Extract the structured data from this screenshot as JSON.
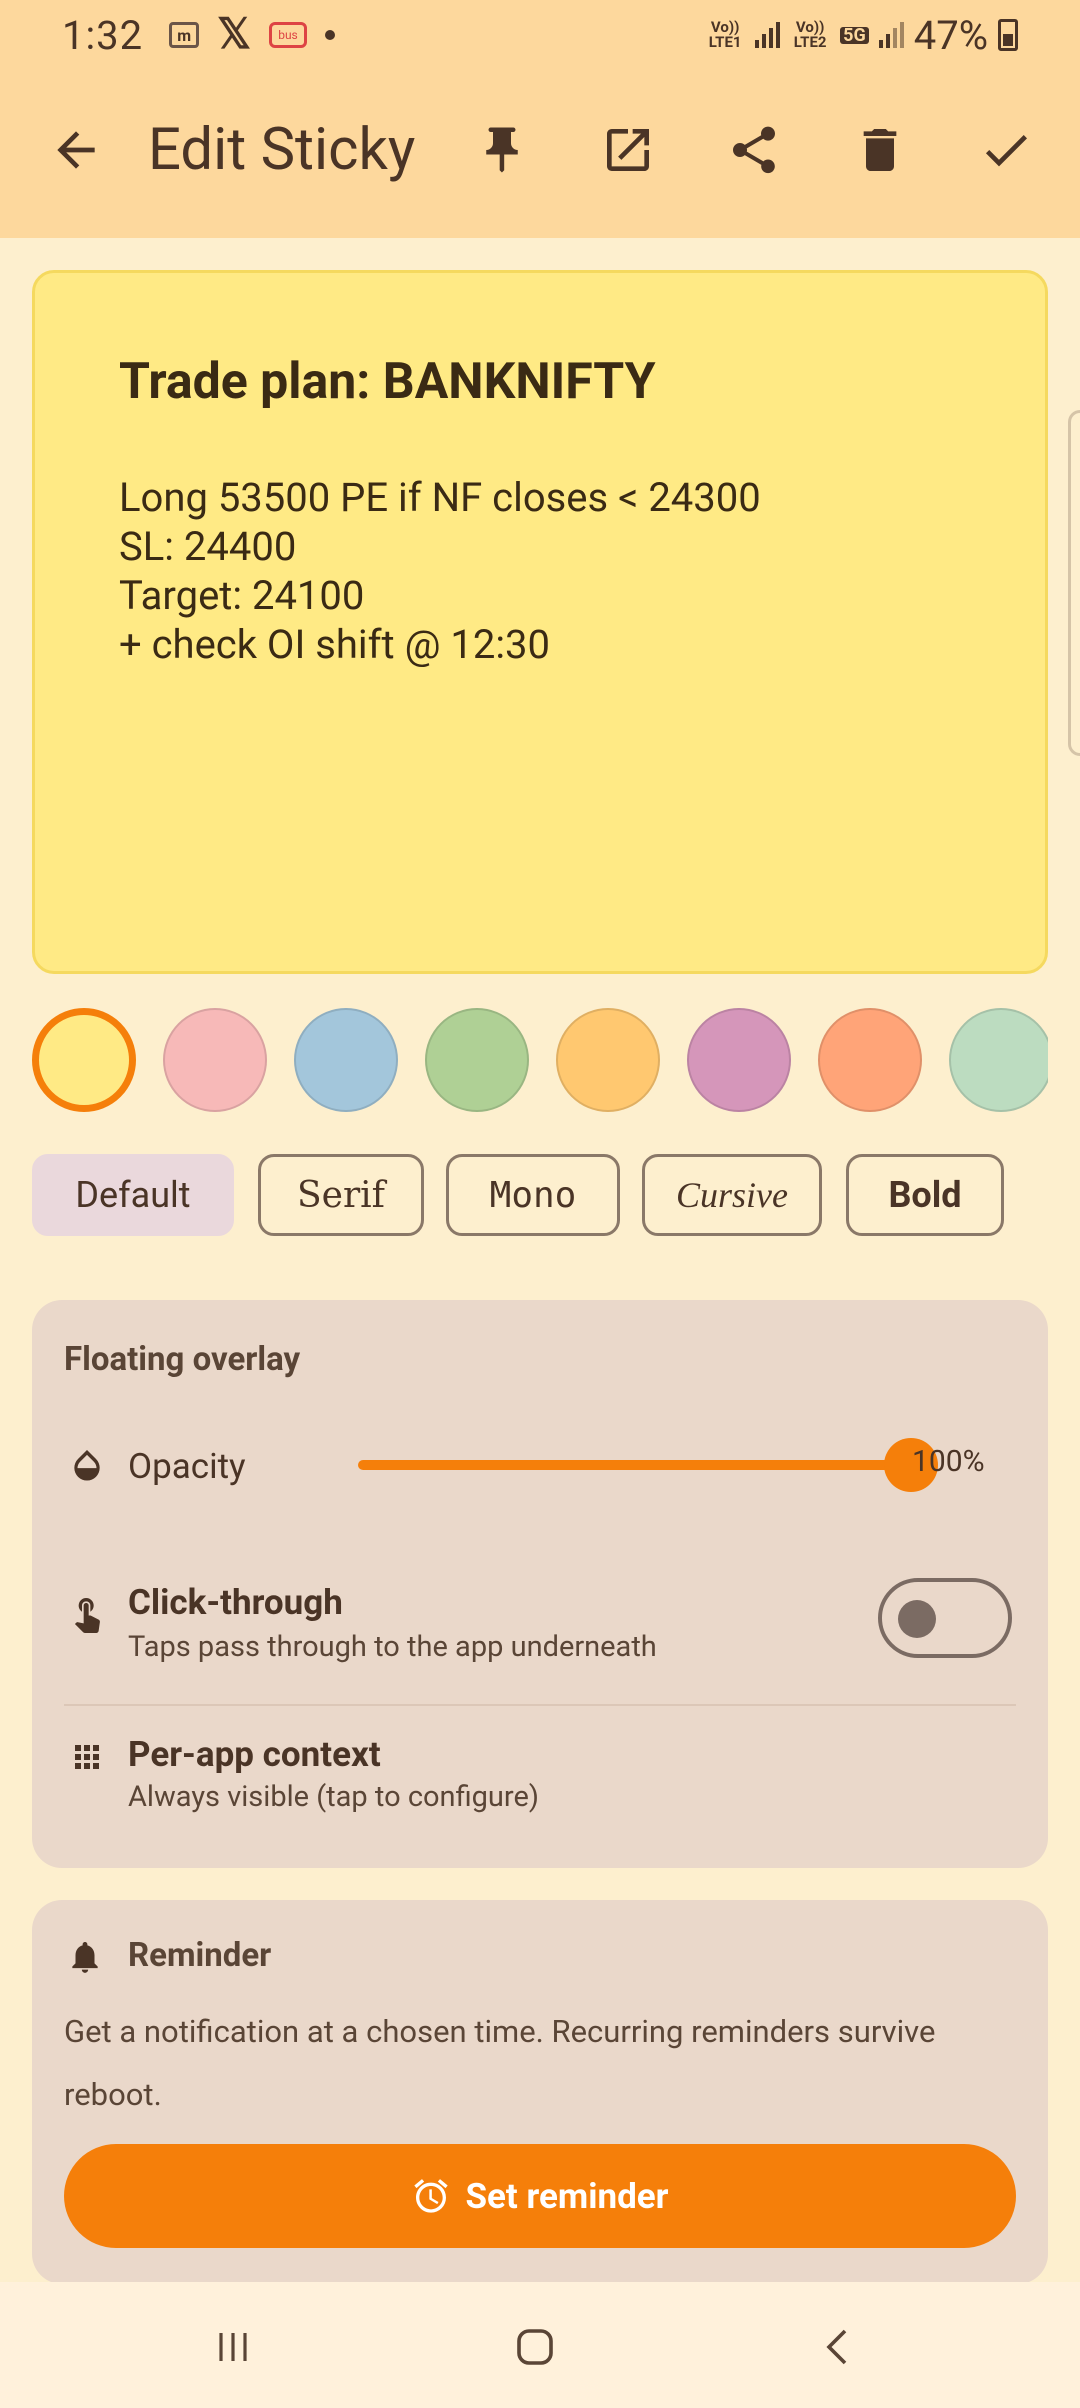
{
  "status_bar": {
    "time": "1:32",
    "net1": "Vo)) LTE1",
    "net2": "Vo)) LTE2",
    "network_badge": "5G",
    "battery": "47%"
  },
  "app_bar": {
    "title": "Edit Sticky",
    "icons": [
      "back-arrow-icon",
      "pin-icon",
      "open-external-icon",
      "share-icon",
      "delete-icon",
      "check-icon"
    ]
  },
  "note": {
    "title": "Trade plan: BANKNIFTY",
    "body": "Long 53500 PE if NF closes < 24300\nSL: 24400\nTarget: 24100\n+ check OI shift @ 12:30",
    "color": "#ffea85"
  },
  "swatches": [
    {
      "color": "#ffea85",
      "selected": true
    },
    {
      "color": "#f7b9b8",
      "selected": false
    },
    {
      "color": "#a3c6db",
      "selected": false
    },
    {
      "color": "#afd095",
      "selected": false
    },
    {
      "color": "#ffc870",
      "selected": false
    },
    {
      "color": "#d596ba",
      "selected": false
    },
    {
      "color": "#ffa478",
      "selected": false
    },
    {
      "color": "#bcdcc0",
      "selected": false
    }
  ],
  "fonts": [
    "Default",
    "Serif",
    "Mono",
    "Cursive",
    "Bold"
  ],
  "overlay": {
    "title": "Floating overlay",
    "opacity_label": "Opacity",
    "opacity_value": 100,
    "opacity_text": "100%",
    "click_through_label": "Click-through",
    "click_through_sub": "Taps pass through to the app underneath",
    "click_through_enabled": false,
    "per_app_label": "Per-app context",
    "per_app_sub": "Always visible (tap to configure)"
  },
  "reminder": {
    "title": "Reminder",
    "description": "Get a notification at a chosen time. Recurring reminders survive reboot.",
    "button_label": "Set reminder"
  },
  "colors": {
    "accent": "#f57f0a",
    "app_bar": "#fdd89d",
    "background": "#fdefce",
    "card": "#ead8ca"
  }
}
